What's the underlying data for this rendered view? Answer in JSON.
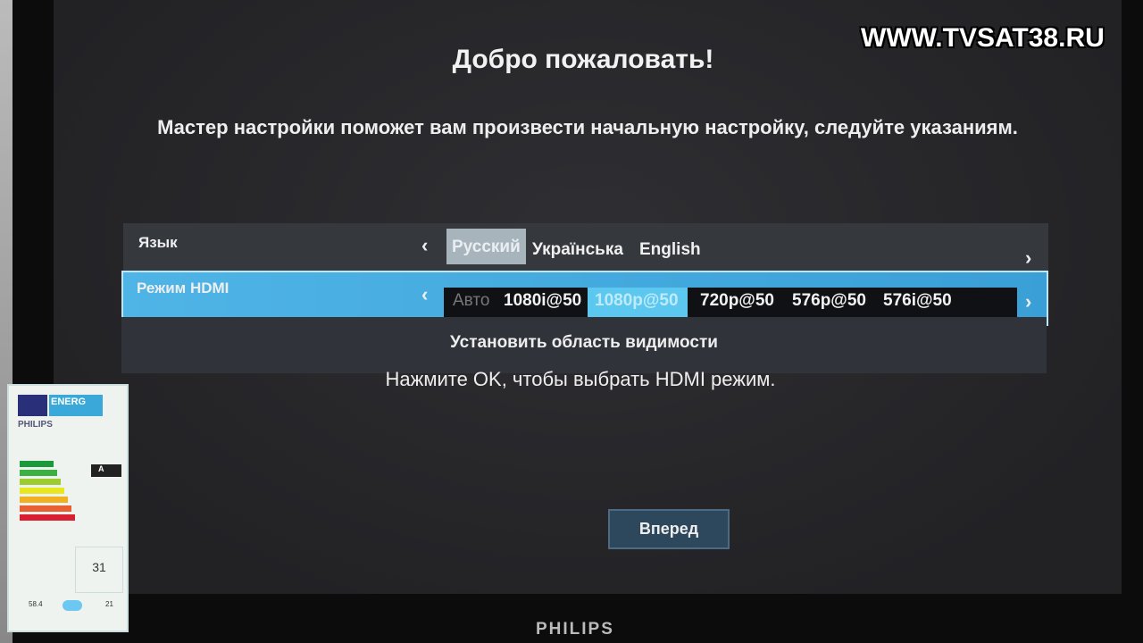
{
  "watermark": "WWW.TVSAT38.RU",
  "title": "Добро пожаловать!",
  "subtitle": "Мастер настройки поможет вам произвести начальную настройку, следуйте указаниям.",
  "language": {
    "label": "Язык",
    "options": [
      "Русский",
      "Українська",
      "English"
    ],
    "selected": "Русский"
  },
  "hdmi": {
    "label": "Режим HDMI",
    "options": [
      "Авто",
      "1080i@50",
      "1080p@50",
      "720p@50",
      "576p@50",
      "576i@50"
    ],
    "selected": "1080p@50"
  },
  "visible_area": "Установить область видимости",
  "hint": "Нажмите OK, чтобы выбрать HDMI режим.",
  "next_button": "Вперед",
  "monitor_brand": "PHILIPS",
  "energy_label": {
    "header": "ENERG",
    "brand": "PHILIPS",
    "class": "A",
    "power": "31",
    "value1": "58.4",
    "value2": "21"
  },
  "colors": {
    "highlight": "#4fb4e6",
    "selected_language": "#a8b4bc",
    "button": "#2d475d"
  }
}
